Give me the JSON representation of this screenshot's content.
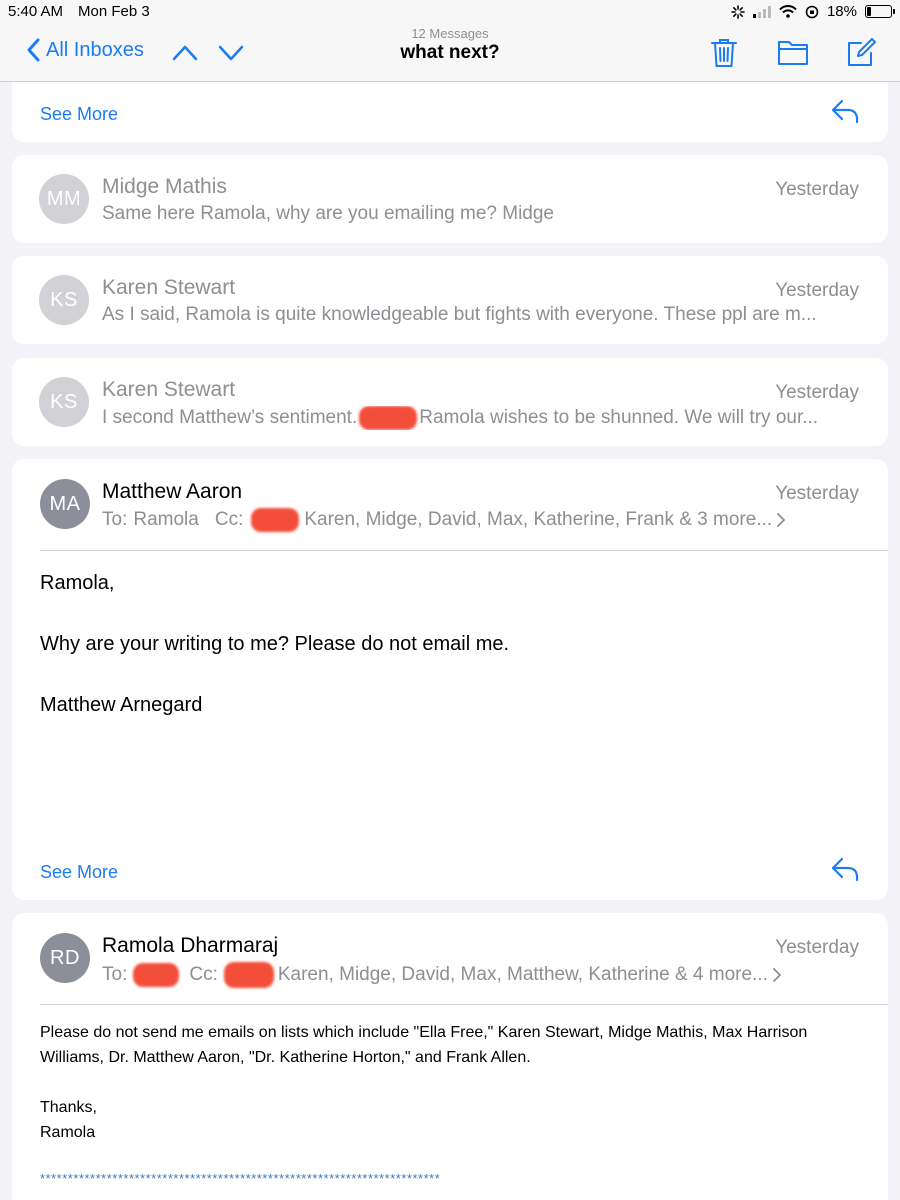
{
  "status_bar": {
    "time": "5:40 AM",
    "date": "Mon Feb 3",
    "battery_percent": "18%",
    "battery_level": 0.18
  },
  "nav": {
    "back_label": "All Inboxes",
    "message_count": "12 Messages",
    "title": "what next?"
  },
  "top_card": {
    "see_more": "See More"
  },
  "messages": [
    {
      "initials": "MM",
      "sender": "Midge Mathis",
      "date": "Yesterday",
      "preview": "Same here Ramola, why are you emailing me? Midge"
    },
    {
      "initials": "KS",
      "sender": "Karen Stewart",
      "date": "Yesterday",
      "preview": "As I said, Ramola is quite knowledgeable but fights with everyone. These ppl are m..."
    },
    {
      "initials": "KS",
      "sender": "Karen Stewart",
      "date": "Yesterday",
      "preview_a": "I second Matthew’s sentiment.",
      "preview_b": "Ramola wishes to be shunned. We will try our..."
    }
  ],
  "matthew": {
    "initials": "MA",
    "sender": "Matthew Aaron",
    "date": "Yesterday",
    "to_label": "To:",
    "to_value": "Ramola",
    "cc_label": "Cc:",
    "cc_value": "Karen, Midge, David, Max, Katherine, Frank & 3 more...",
    "body_1": "Ramola,",
    "body_2": "Why are your writing to me? Please do not email me.",
    "body_3": "Matthew Arnegard",
    "see_more": "See More"
  },
  "ramola": {
    "initials": "RD",
    "sender": "Ramola Dharmaraj",
    "date": "Yesterday",
    "to_label": "To:",
    "cc_label": "Cc:",
    "cc_value": "Karen, Midge, David, Max, Matthew, Katherine & 4 more...",
    "body_1": "Please do not send me emails on lists which include \"Ella Free,\"  Karen Stewart, Midge Mathis, Max Harrison Williams, Dr. Matthew Aaron, \"Dr. Katherine Horton,\" and Frank Allen.",
    "body_2": "Thanks,",
    "body_3": "Ramola",
    "stars": "************************************************************************"
  },
  "colors": {
    "accent": "#1a7cf5",
    "secondary_text": "#8e8e93",
    "redaction": "#f2402a"
  }
}
